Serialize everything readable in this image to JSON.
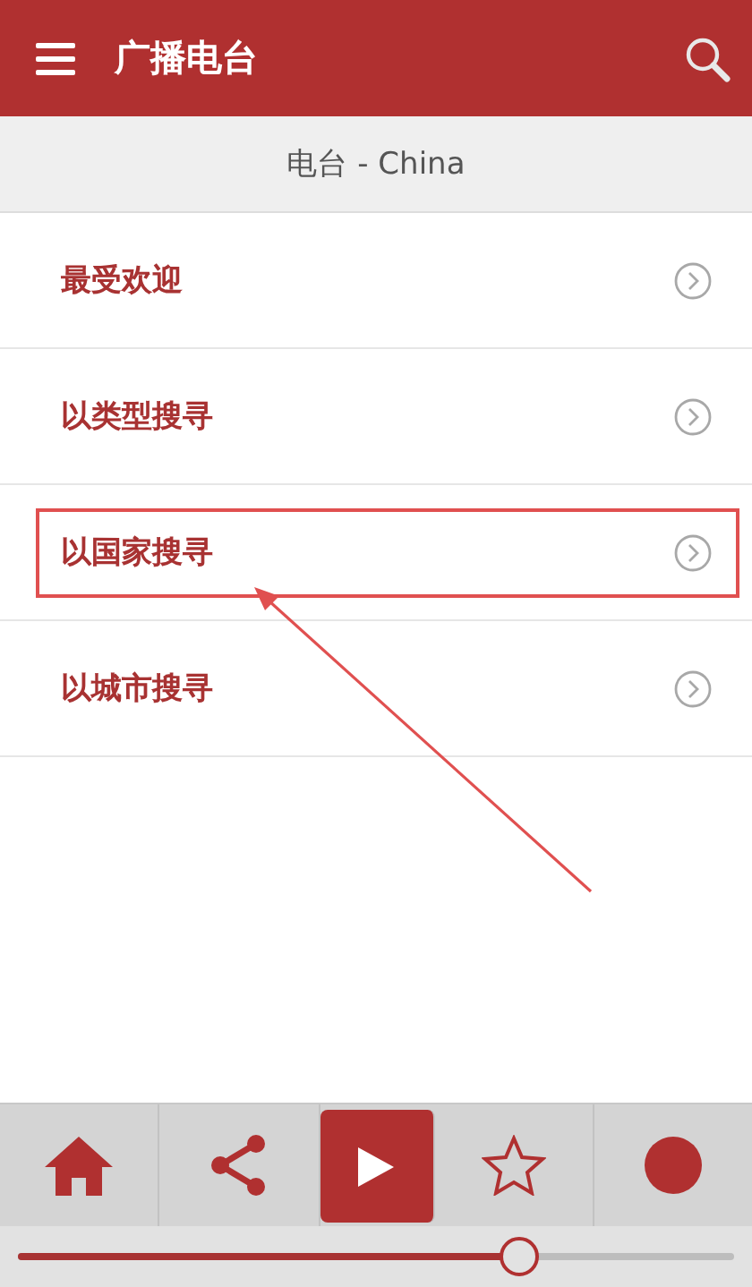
{
  "app_bar": {
    "title": "广播电台"
  },
  "subheader": {
    "title": "电台 - China"
  },
  "menu_items": [
    {
      "label": "最受欢迎",
      "highlighted": false
    },
    {
      "label": "以类型搜寻",
      "highlighted": false
    },
    {
      "label": "以国家搜寻",
      "highlighted": true
    },
    {
      "label": "以城市搜寻",
      "highlighted": false
    }
  ],
  "player_buttons": [
    {
      "kind": "home",
      "selected": false
    },
    {
      "kind": "share",
      "selected": false
    },
    {
      "kind": "play",
      "selected": true
    },
    {
      "kind": "favorite",
      "selected": false
    },
    {
      "kind": "record",
      "selected": false
    }
  ],
  "progress": {
    "level": 0.7
  }
}
